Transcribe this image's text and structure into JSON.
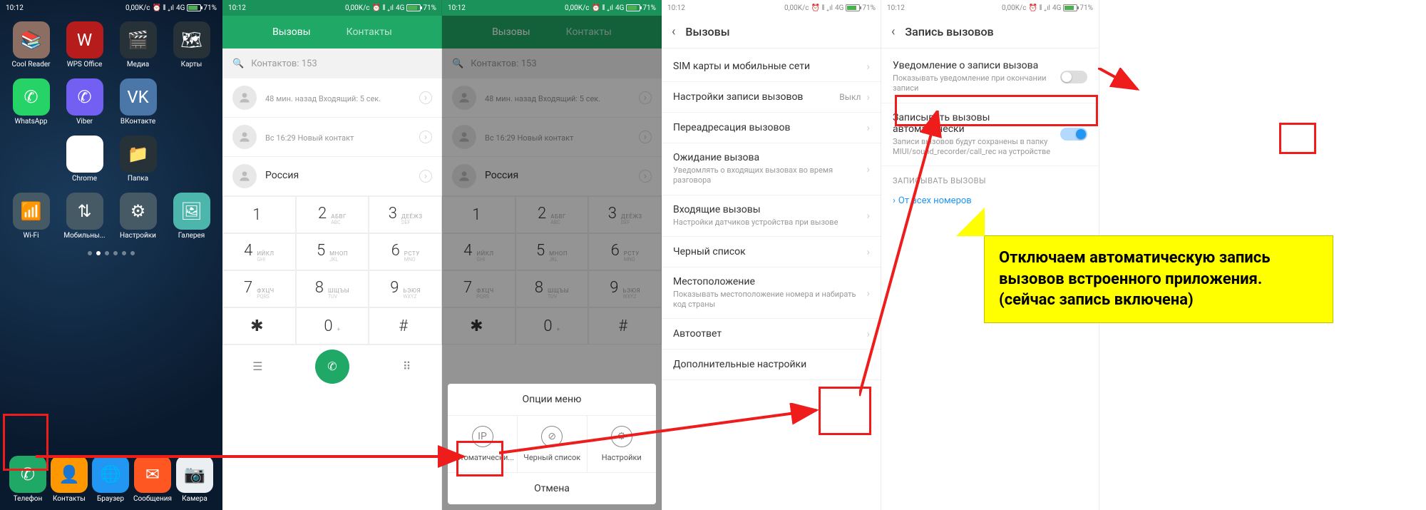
{
  "status": {
    "time": "10:12",
    "speed": "0,00K/c",
    "net": "4G",
    "battery": "71%"
  },
  "home": {
    "apps": [
      {
        "n": "Cool Reader",
        "c": "#8d6e63",
        "e": "📚"
      },
      {
        "n": "WPS Office",
        "c": "#b71c1c",
        "e": "W"
      },
      {
        "n": "Медиа",
        "c": "#263238",
        "e": "🎬"
      },
      {
        "n": "Карты",
        "c": "#263238",
        "e": "🗺"
      },
      {
        "n": "WhatsApp",
        "c": "#25d366",
        "e": "✆"
      },
      {
        "n": "Viber",
        "c": "#7360f2",
        "e": "✆"
      },
      {
        "n": "ВКонтакте",
        "c": "#4a76a8",
        "e": "VK"
      },
      {
        "n": "",
        "c": "transparent",
        "e": ""
      },
      {
        "n": "",
        "c": "transparent",
        "e": ""
      },
      {
        "n": "Chrome",
        "c": "#fff",
        "e": "◉"
      },
      {
        "n": "Папка",
        "c": "#263238",
        "e": "📁"
      },
      {
        "n": "",
        "c": "transparent",
        "e": ""
      },
      {
        "n": "Wi-Fi",
        "c": "#455a64",
        "e": "📶"
      },
      {
        "n": "Мобильны...",
        "c": "#455a64",
        "e": "⇅"
      },
      {
        "n": "Настройки",
        "c": "#455a64",
        "e": "⚙"
      },
      {
        "n": "Галерея",
        "c": "#4db6ac",
        "e": "🖼"
      }
    ],
    "dock": [
      {
        "n": "Телефон",
        "c": "#1fa866",
        "e": "✆"
      },
      {
        "n": "Контакты",
        "c": "#ff9800",
        "e": "👤"
      },
      {
        "n": "Браузер",
        "c": "#2196f3",
        "e": "🌐"
      },
      {
        "n": "Сообщения",
        "c": "#ff5722",
        "e": "✉"
      },
      {
        "n": "Камера",
        "c": "#eceff1",
        "e": "📷"
      }
    ]
  },
  "dialer": {
    "tab_calls": "Вызовы",
    "tab_contacts": "Контакты",
    "search": "Контактов: 153",
    "entries": [
      {
        "n": "",
        "s": "48 мин. назад Входящий: 5 сек."
      },
      {
        "n": "",
        "s": "Вс 16:29 Новый контакт"
      },
      {
        "n": "Россия",
        "s": ""
      }
    ],
    "keys": [
      {
        "n": "1",
        "a": "",
        "b": ""
      },
      {
        "n": "2",
        "a": "АБВГ",
        "b": "ABC"
      },
      {
        "n": "3",
        "a": "ДЕЁЖЗ",
        "b": "DEF"
      },
      {
        "n": "4",
        "a": "ИЙКЛ",
        "b": "GHI"
      },
      {
        "n": "5",
        "a": "МНОП",
        "b": "JKL"
      },
      {
        "n": "6",
        "a": "РСТУ",
        "b": "MNO"
      },
      {
        "n": "7",
        "a": "ФХЦЧ",
        "b": "PQRS"
      },
      {
        "n": "8",
        "a": "ШЩЪЫ",
        "b": "TUV"
      },
      {
        "n": "9",
        "a": "ЬЭЮЯ",
        "b": "WXYZ"
      },
      {
        "n": "✱",
        "a": "",
        "b": ""
      },
      {
        "n": "0",
        "a": "+",
        "b": ""
      },
      {
        "n": "#",
        "a": "",
        "b": ""
      }
    ]
  },
  "menu": {
    "title": "Опции меню",
    "items": [
      {
        "l": "Автоматически...",
        "i": "IP"
      },
      {
        "l": "Черный список",
        "i": "⊘"
      },
      {
        "l": "Настройки",
        "i": "⚙"
      }
    ],
    "cancel": "Отмена"
  },
  "set": {
    "title": "Вызовы",
    "items": [
      {
        "t": "SIM карты и мобильные сети"
      },
      {
        "t": "Настройки записи вызовов",
        "v": "Выкл"
      },
      {
        "t": "Переадресация вызовов"
      },
      {
        "t": "Ожидание вызова",
        "s": "Уведомлять о входящих вызовах во время разговора"
      },
      {
        "t": "Входящие вызовы",
        "s": "Настройки датчиков устройства при вызове"
      },
      {
        "t": "Черный список"
      },
      {
        "t": "Местоположение",
        "s": "Показывать местоположение номера и набирать код страны"
      },
      {
        "t": "Автоответ"
      },
      {
        "t": "Дополнительные настройки"
      }
    ]
  },
  "rec": {
    "title": "Запись вызовов",
    "i1": {
      "t": "Уведомление о записи вызова",
      "s": "Показывать уведомление при окончании записи"
    },
    "i2": {
      "t": "Записывать вызовы автоматически",
      "s": "Записи вызовов будут сохранены в папку MIUI/sound_recorder/call_rec на устройстве"
    },
    "section": "ЗАПИСЫВАТЬ ВЫЗОВЫ",
    "link": "От всех номеров"
  },
  "callout": "Отключаем автоматическую запись вызовов встроенного приложения.\n(сейчас запись включена)"
}
